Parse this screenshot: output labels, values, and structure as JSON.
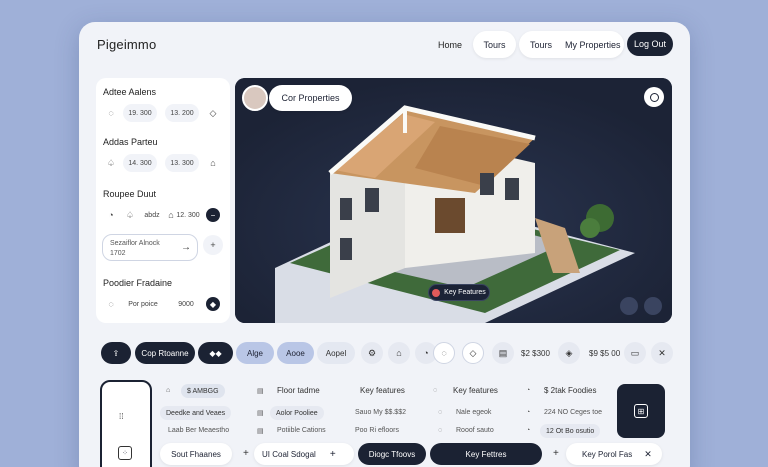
{
  "app": {
    "brand": "Pigeimmo"
  },
  "nav": {
    "home": "Home",
    "tours_active": "Tours",
    "tours": "Tours",
    "my_properties": "My Properties",
    "logout": "Log Out"
  },
  "sidebar": {
    "sections": [
      {
        "title": "Adtee Aalens",
        "v1": "19. 300",
        "v2": "13. 200"
      },
      {
        "title": "Addas Parteu",
        "v1": "14. 300",
        "v2": "13. 300"
      },
      {
        "title": "Roupee Duut",
        "v1": "abdz",
        "v2": "12. 300"
      }
    ],
    "search": {
      "label": "Sezaiflor Alnock",
      "value": "1702"
    },
    "footer": {
      "title": "Poodier Fradaine",
      "v1": "Por poice",
      "v2": "9000"
    }
  },
  "hero": {
    "badge": "Cor Properties",
    "tag": "Key Features"
  },
  "filters": {
    "f1": "Cop Rtoanne",
    "f2": "Alge",
    "f3": "Aooe",
    "f4": "Aopel",
    "p1": "$2 $300",
    "p2": "$9 $5 00"
  },
  "bottom": {
    "chip1": "$ AMBGG",
    "h1": "Floor tadme",
    "h2": "Key features",
    "h3": "Key features",
    "h4": "$ 2tak Foodies",
    "r1": [
      "Deedke and Veaes",
      "Aolor Pooliee",
      "Sauo My $$.$$2",
      "Nale egeok",
      "224 NO Ceges toe"
    ],
    "r2": [
      "Laab Ber Meaestho",
      "Potiible Cations",
      "Poo Ri efloors",
      "Rooof sauto",
      "12 Ot Bo osutio"
    ],
    "b1": "Sout Fhaanes",
    "b2": "UI Coal Sdogal",
    "b3": "Diogc Tfoovs",
    "b4": "Key Fettres",
    "b5": "Key Porol Fas"
  }
}
